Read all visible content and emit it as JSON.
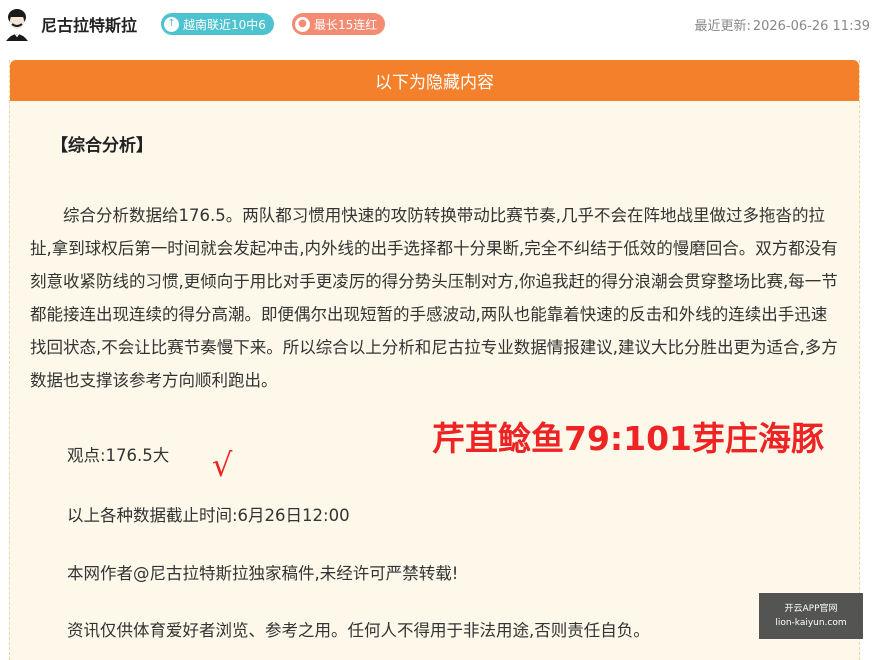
{
  "header": {
    "author_name": "尼古拉特斯拉",
    "badge_streak": "越南联近10中6",
    "badge_max": "最长15连红",
    "updated_label": "最近更新:",
    "updated_time": "2026-06-26 11:39"
  },
  "hidden": {
    "bar_label": "以下为隐藏内容"
  },
  "article": {
    "section_title": "【综合分析】",
    "paragraph": "综合分析数据给176.5。两队都习惯用快速的攻防转换带动比赛节奏,几乎不会在阵地战里做过多拖沓的拉扯,拿到球权后第一时间就会发起冲击,内外线的出手选择都十分果断,完全不纠结于低效的慢磨回合。双方都没有刻意收紧防线的习惯,更倾向于用比对手更凌厉的得分势头压制对方,你追我赶的得分浪潮会贯穿整场比赛,每一节都能接连出现连续的得分高潮。即便偶尔出现短暂的手感波动,两队也能靠着快速的反击和外线的连续出手迅速找回状态,不会让比赛节奏慢下来。所以综合以上分析和尼古拉专业数据情报建议,建议大比分胜出更为适合,多方数据也支撑该参考方向顺利跑出。",
    "view_line": "观点:176.5大",
    "cutoff_line": "以上各种数据截止时间:6月26日12:00",
    "copyright_line": "本网作者@尼古拉特斯拉独家稿件,未经许可严禁转载!",
    "disclaimer_line": "资讯仅供体育爱好者浏览、参考之用。任何人不得用于非法用途,否则责任自负。"
  },
  "overlay": {
    "score_text": "芹苴鲶鱼79:101芽庄海豚",
    "check_mark": "√"
  },
  "watermark": {
    "line1": "开云APP官网",
    "line2": "lion-kaiyun.com"
  }
}
